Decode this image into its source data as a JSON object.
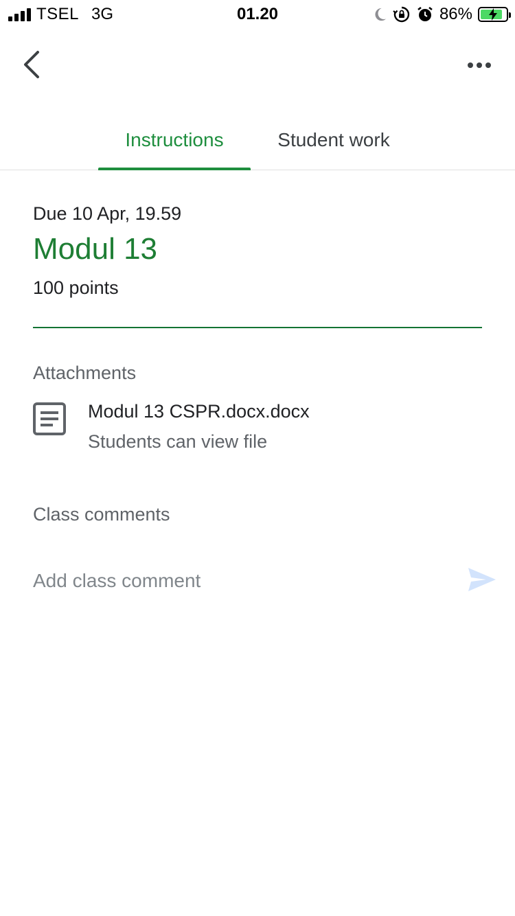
{
  "status_bar": {
    "carrier": "TSEL",
    "network": "3G",
    "time": "01.20",
    "battery_percent": "86%",
    "battery_fill_fraction": 0.86,
    "icons": [
      "signal-icon",
      "moon-icon",
      "orientation-lock-icon",
      "alarm-icon",
      "battery-charging-icon"
    ]
  },
  "app_bar": {
    "back_icon": "chevron-left-icon",
    "more_icon": "more-horizontal-icon"
  },
  "tabs": [
    {
      "label": "Instructions",
      "active": true
    },
    {
      "label": "Student work",
      "active": false
    }
  ],
  "assignment": {
    "due": "Due 10 Apr, 19.59",
    "title": "Modul 13",
    "points": "100 points"
  },
  "attachments": {
    "label": "Attachments",
    "items": [
      {
        "name": "Modul 13 CSPR.docx.docx",
        "subtitle": "Students can view file",
        "icon": "document-icon"
      }
    ]
  },
  "comments": {
    "label": "Class comments",
    "placeholder": "Add class comment",
    "value": "",
    "send_icon": "send-icon"
  },
  "colors": {
    "accent_green": "#1e8e3e",
    "title_green": "#1e7e34",
    "send_disabled": "#d2e3fc",
    "battery_green": "#4cd964"
  }
}
